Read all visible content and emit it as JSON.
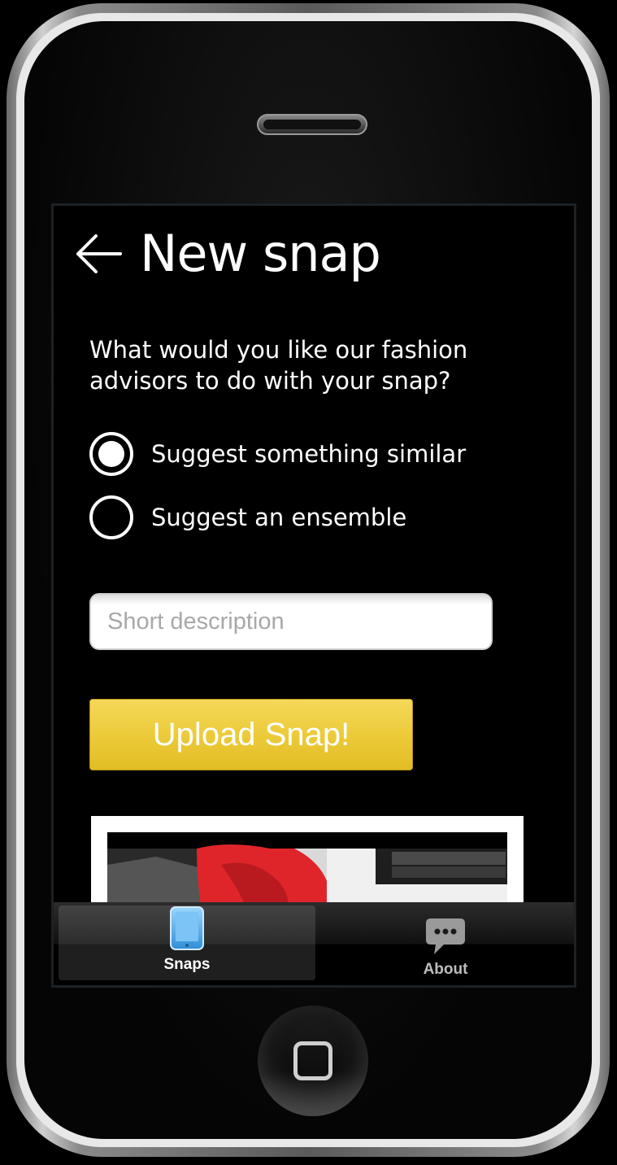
{
  "header": {
    "title": "New snap",
    "back_icon": "left-arrow-icon"
  },
  "form": {
    "question": "What would you like our fashion advisors to do with your snap?",
    "options": [
      {
        "label": "Suggest something similar",
        "selected": true
      },
      {
        "label": "Suggest an ensemble",
        "selected": false
      }
    ],
    "description": {
      "value": "",
      "placeholder": "Short description"
    },
    "upload_label": "Upload Snap!"
  },
  "tabs": [
    {
      "label": "Snaps",
      "icon": "tablet-icon",
      "active": true
    },
    {
      "label": "About",
      "icon": "chat-bubble-icon",
      "active": false
    }
  ],
  "colors": {
    "accent_button": "#ecca3a",
    "tab_active_icon": "#5ab4ee",
    "background": "#000000",
    "text": "#ffffff"
  }
}
